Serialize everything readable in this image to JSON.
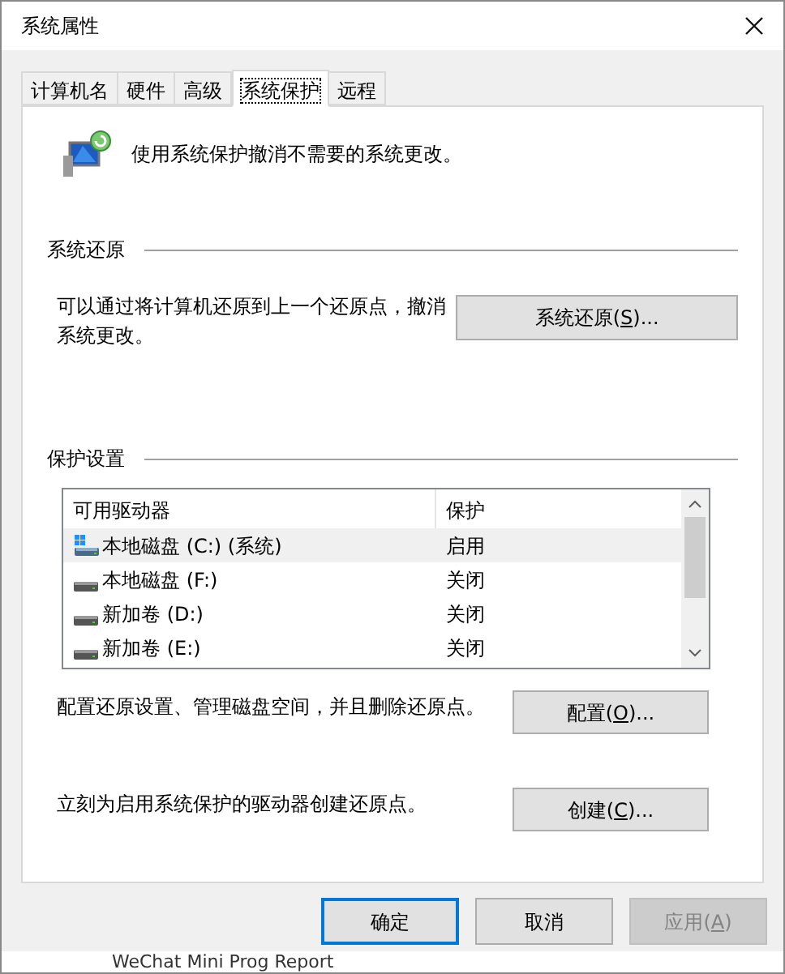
{
  "window": {
    "title": "系统属性"
  },
  "tabs": [
    {
      "label": "计算机名",
      "selected": false
    },
    {
      "label": "硬件",
      "selected": false
    },
    {
      "label": "高级",
      "selected": false
    },
    {
      "label": "系统保护",
      "selected": true
    },
    {
      "label": "远程",
      "selected": false
    }
  ],
  "intro": "使用系统保护撤消不需要的系统更改。",
  "restore": {
    "heading": "系统还原",
    "text": "可以通过将计算机还原到上一个还原点，撤消系统更改。",
    "button": {
      "before": "系统还原(",
      "key": "S",
      "after": ")..."
    }
  },
  "protection": {
    "heading": "保护设置",
    "columns": [
      "可用驱动器",
      "保护"
    ],
    "rows": [
      {
        "kind": "system",
        "name": "本地磁盘 (C:) (系统)",
        "protection": "启用",
        "selected": true
      },
      {
        "kind": "plain",
        "name": "本地磁盘 (F:)",
        "protection": "关闭",
        "selected": false
      },
      {
        "kind": "plain",
        "name": "新加卷 (D:)",
        "protection": "关闭",
        "selected": false
      },
      {
        "kind": "plain",
        "name": "新加卷 (E:)",
        "protection": "关闭",
        "selected": false
      }
    ],
    "configure": {
      "text": "配置还原设置、管理磁盘空间，并且删除还原点。",
      "button": {
        "before": "配置(",
        "key": "O",
        "after": ")..."
      }
    },
    "create": {
      "text": "立刻为启用系统保护的驱动器创建还原点。",
      "button": {
        "before": "创建(",
        "key": "C",
        "after": ")..."
      }
    }
  },
  "buttons": [
    {
      "label": "确定",
      "default": true,
      "disabled": false
    },
    {
      "label": "取消",
      "default": false,
      "disabled": false
    },
    {
      "before": "应用(",
      "key": "A",
      "after": ")",
      "default": false,
      "disabled": true
    }
  ],
  "background_text": "WeChat Mini Prog Report"
}
